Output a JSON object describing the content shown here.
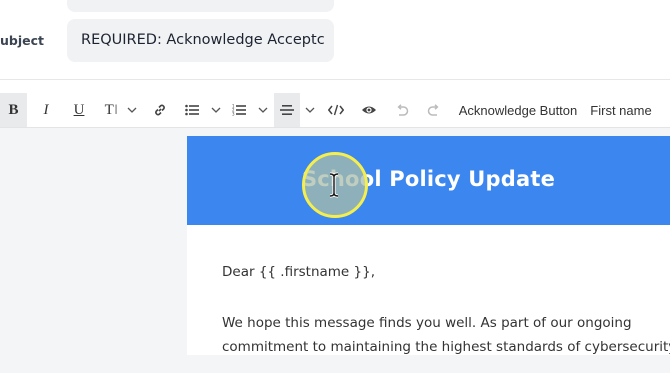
{
  "subject": {
    "label": "ubject",
    "value": "REQUIRED: Acknowledge Acceptc"
  },
  "toolbar": {
    "bold": "B",
    "italic": "I",
    "underline": "U",
    "text_size": "T",
    "acknowledge_button": "Acknowledge Button",
    "first_name": "First name"
  },
  "email": {
    "banner_title": "School Policy Update",
    "banner_color": "#3b86ef",
    "greeting": "Dear {{ .firstname }},",
    "body_lines": [
      "We hope this message finds you well. As part of our ongoing",
      "commitment to maintaining the highest standards of cybersecurity for"
    ]
  },
  "icons": {
    "link": "link-icon",
    "bullet_list": "bullet-list-icon",
    "numbered_list": "numbered-list-icon",
    "align": "align-center-icon",
    "code": "code-icon",
    "preview": "eye-icon",
    "undo": "undo-icon",
    "redo": "redo-icon",
    "cursor": "text-cursor-icon"
  }
}
